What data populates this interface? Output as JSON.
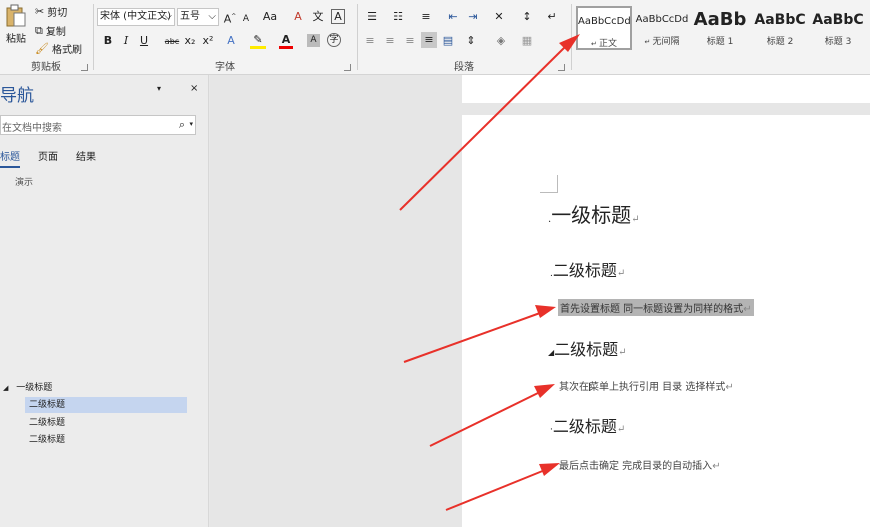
{
  "ribbon": {
    "clipboard": {
      "paste": "粘贴",
      "cut": "剪切",
      "copy": "复制",
      "format_painter": "格式刷",
      "label": "剪贴板"
    },
    "font": {
      "name": "宋体 (中文正文)",
      "size": "五号",
      "grow": "A",
      "shrink": "A",
      "case": "Aa",
      "clear": "A",
      "pinyin": "文",
      "border": "A",
      "bold": "B",
      "italic": "I",
      "underline": "U",
      "strike": "abc",
      "subscript": "x₂",
      "superscript": "x²",
      "label": "字体"
    },
    "paragraph": {
      "label": "段落"
    },
    "styles": [
      {
        "preview": "AaBbCcDd",
        "name": "正文"
      },
      {
        "preview": "AaBbCcDd",
        "name": "无间隔"
      },
      {
        "preview": "AaBb",
        "name": "标题 1"
      },
      {
        "preview": "AaBbC",
        "name": "标题 2"
      },
      {
        "preview": "AaBbC",
        "name": "标题 3"
      }
    ]
  },
  "nav": {
    "title": "导航",
    "search_placeholder": "在文档中搜索",
    "tabs": [
      "标题",
      "页面",
      "结果"
    ],
    "demo_label": "演示",
    "tree": {
      "root": "一级标题",
      "children": [
        "二级标题",
        "二级标题",
        "二级标题"
      ]
    }
  },
  "document": {
    "h1": "一级标题",
    "h2a": "二级标题",
    "p1": "首先设置标题 同一标题设置为同样的格式",
    "h2b": "二级标题",
    "p2": "其次在菜单上执行引用 目录 选择样式",
    "h2c": "二级标题",
    "p3": "最后点击确定 完成目录的自动插入",
    "para_mark": "↵"
  },
  "colors": {
    "accent": "#2b579a",
    "arrow": "#e8312a",
    "highlight": "#b4b4b4"
  }
}
